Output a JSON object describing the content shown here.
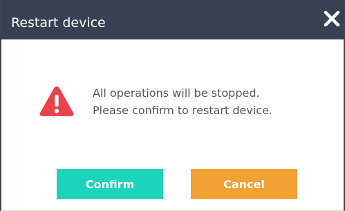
{
  "dialog": {
    "title": "Restart device",
    "close_icon": "close-icon",
    "warning_icon": "warning-triangle-icon",
    "message_line1": "All operations will be stopped.",
    "message_line2": "Please confirm to restart device.",
    "confirm_label": "Confirm",
    "cancel_label": "Cancel"
  },
  "colors": {
    "titlebar": "#364254",
    "warning": "#e8424b",
    "confirm": "#1dd3bd",
    "cancel": "#f2a133",
    "message_text": "#555555"
  }
}
